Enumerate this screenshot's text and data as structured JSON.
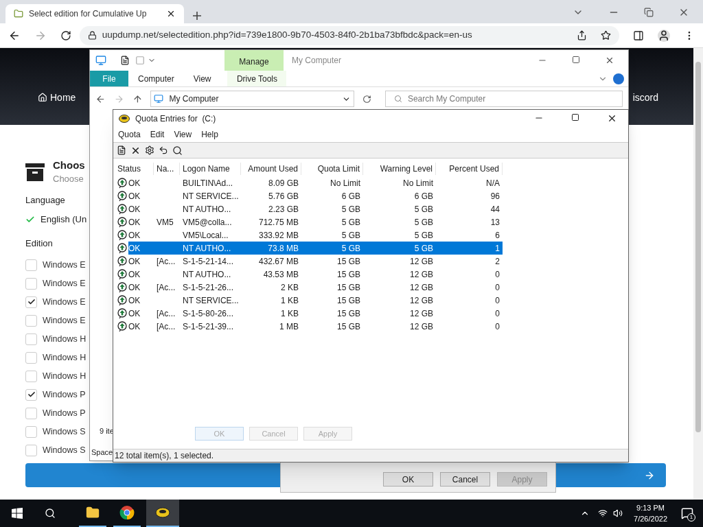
{
  "browser": {
    "tab_title": "Select edition for Cumulative Up",
    "url": "uupdump.net/selectedition.php?id=739e1800-9b70-4503-84f0-2b1ba73bfbdc&pack=en-us"
  },
  "page": {
    "nav": [
      {
        "label": "Home"
      },
      {
        "label": "iscord"
      }
    ],
    "heading": "Choos",
    "subheading": "Choose",
    "language_label": "Language",
    "language_value": "English (Un",
    "edition_label": "Edition",
    "editions": [
      {
        "label": "Windows E",
        "checked": false
      },
      {
        "label": "Windows E",
        "checked": false
      },
      {
        "label": "Windows E",
        "checked": true
      },
      {
        "label": "Windows E",
        "checked": false
      },
      {
        "label": "Windows H",
        "checked": false
      },
      {
        "label": "Windows H",
        "checked": false
      },
      {
        "label": "Windows H",
        "checked": false
      },
      {
        "label": "Windows P",
        "checked": true
      },
      {
        "label": "Windows P",
        "checked": false
      },
      {
        "label": "Windows S",
        "checked": false
      },
      {
        "label": "Windows S",
        "checked": false
      }
    ]
  },
  "explorer": {
    "title": "My Computer",
    "tabs": [
      {
        "label": "File",
        "kind": "file"
      },
      {
        "label": "Computer",
        "kind": "plain"
      },
      {
        "label": "View",
        "kind": "plain"
      },
      {
        "label": "Drive Tools",
        "kind": "context"
      }
    ],
    "context_label": "Manage",
    "address": "My Computer",
    "search_placeholder": "Search My Computer",
    "item_count": "9 ite",
    "status_left": "Space"
  },
  "quota_window": {
    "title": "Quota Entries for  (C:)",
    "menus": [
      "Quota",
      "Edit",
      "View",
      "Help"
    ],
    "columns": [
      "Status",
      "Na...",
      "Logon Name",
      "Amount Used",
      "Quota Limit",
      "Warning Level",
      "Percent Used"
    ],
    "rows": [
      {
        "status": "OK",
        "logon": "BUILTIN\\Ad...",
        "amount": "8.09 GB",
        "limit": "No Limit",
        "warning": "No Limit",
        "percent": "N/A",
        "selected": false
      },
      {
        "status": "OK",
        "logon": "NT SERVICE...",
        "amount": "5.76 GB",
        "limit": "6 GB",
        "warning": "6 GB",
        "percent": "96",
        "selected": false
      },
      {
        "status": "OK",
        "logon": "NT AUTHO...",
        "amount": "2.23 GB",
        "limit": "5 GB",
        "warning": "5 GB",
        "percent": "44",
        "selected": false
      },
      {
        "status": "OK",
        "name": "VM5",
        "logon": "VM5@colla...",
        "amount": "712.75 MB",
        "limit": "5 GB",
        "warning": "5 GB",
        "percent": "13",
        "selected": false
      },
      {
        "status": "OK",
        "logon": "VM5\\Local...",
        "amount": "333.92 MB",
        "limit": "5 GB",
        "warning": "5 GB",
        "percent": "6",
        "selected": false
      },
      {
        "status": "OK",
        "logon": "NT AUTHO...",
        "amount": "73.8 MB",
        "limit": "5 GB",
        "warning": "5 GB",
        "percent": "1",
        "selected": true
      },
      {
        "status": "OK",
        "name": "[Ac...",
        "logon": "S-1-5-21-14...",
        "amount": "432.67 MB",
        "limit": "15 GB",
        "warning": "12 GB",
        "percent": "2",
        "selected": false
      },
      {
        "status": "OK",
        "logon": "NT AUTHO...",
        "amount": "43.53 MB",
        "limit": "15 GB",
        "warning": "12 GB",
        "percent": "0",
        "selected": false
      },
      {
        "status": "OK",
        "name": "[Ac...",
        "logon": "S-1-5-21-26...",
        "amount": "2 KB",
        "limit": "15 GB",
        "warning": "12 GB",
        "percent": "0",
        "selected": false
      },
      {
        "status": "OK",
        "logon": "NT SERVICE...",
        "amount": "1 KB",
        "limit": "15 GB",
        "warning": "12 GB",
        "percent": "0",
        "selected": false
      },
      {
        "status": "OK",
        "name": "[Ac...",
        "logon": "S-1-5-80-26...",
        "amount": "1 KB",
        "limit": "15 GB",
        "warning": "12 GB",
        "percent": "0",
        "selected": false
      },
      {
        "status": "OK",
        "name": "[Ac...",
        "logon": "S-1-5-21-39...",
        "amount": "1 MB",
        "limit": "15 GB",
        "warning": "12 GB",
        "percent": "0",
        "selected": false
      }
    ],
    "status_bar": "12 total item(s), 1 selected."
  },
  "ghost_dialog": {
    "buttons": [
      "OK",
      "Cancel",
      "Apply"
    ]
  },
  "back_dialog": {
    "buttons": [
      {
        "label": "OK",
        "disabled": false
      },
      {
        "label": "Cancel",
        "disabled": false
      },
      {
        "label": "Apply",
        "disabled": true
      }
    ]
  },
  "taskbar": {
    "time": "9:13 PM",
    "date": "7/26/2022",
    "notifications": "1"
  }
}
